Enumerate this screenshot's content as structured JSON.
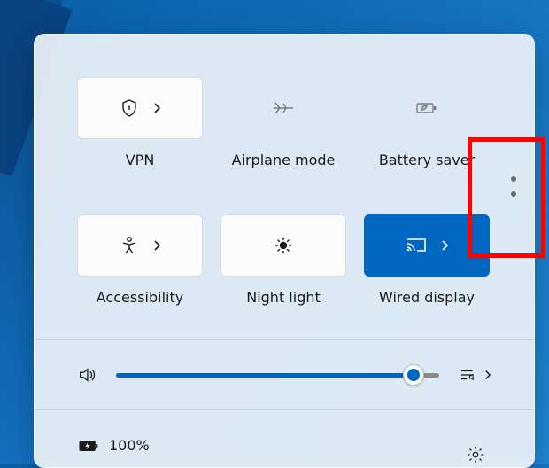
{
  "tiles": {
    "vpn": {
      "label": "VPN"
    },
    "airplane": {
      "label": "Airplane mode"
    },
    "battery_saver": {
      "label": "Battery saver"
    },
    "accessibility": {
      "label": "Accessibility"
    },
    "night_light": {
      "label": "Night light"
    },
    "wired_display": {
      "label": "Wired display"
    }
  },
  "volume": {
    "percent": 92
  },
  "battery": {
    "text": "100%"
  },
  "colors": {
    "accent": "#0067c0"
  }
}
